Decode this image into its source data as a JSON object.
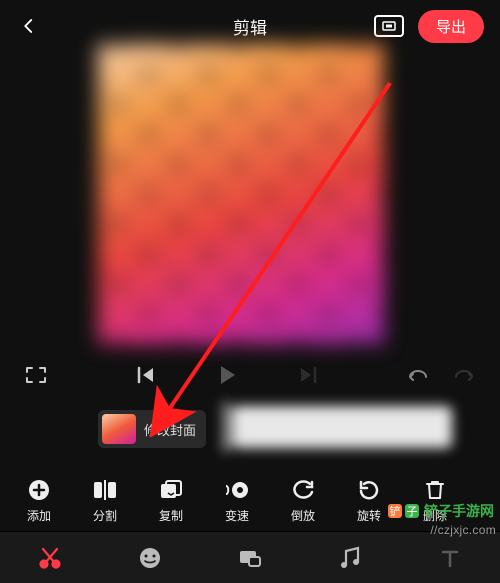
{
  "header": {
    "title": "剪辑",
    "export_label": "导出"
  },
  "cover": {
    "label": "修改封面"
  },
  "toolbar": [
    {
      "id": "add",
      "label": "添加"
    },
    {
      "id": "split",
      "label": "分割"
    },
    {
      "id": "copy",
      "label": "复制"
    },
    {
      "id": "speed",
      "label": "变速"
    },
    {
      "id": "reverse",
      "label": "倒放"
    },
    {
      "id": "rotate",
      "label": "旋转"
    },
    {
      "id": "delete",
      "label": "删除"
    }
  ],
  "watermark": {
    "brand": "铲子手游网",
    "url": "//czjxjc.com"
  }
}
